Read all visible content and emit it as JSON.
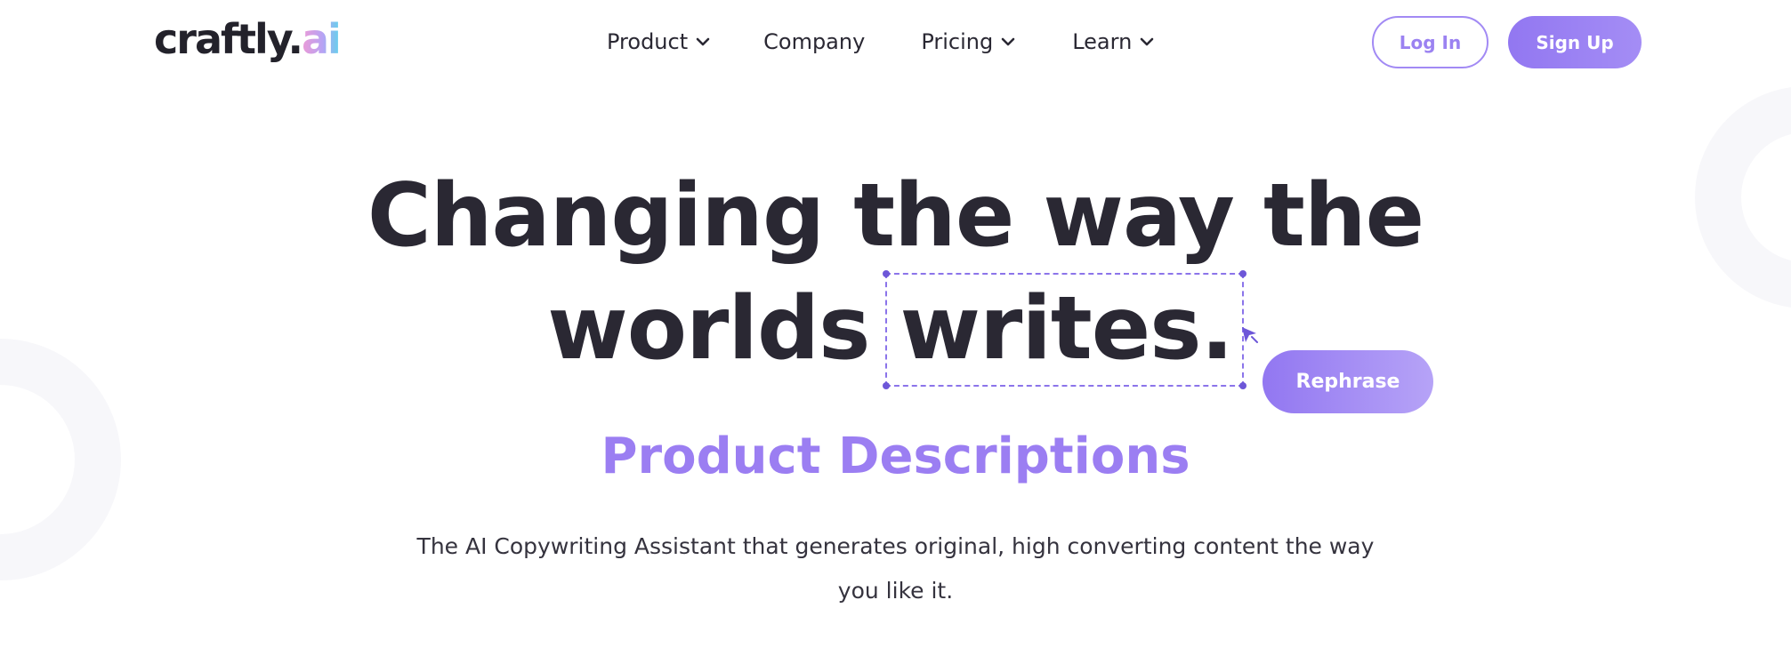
{
  "header": {
    "logo": {
      "main": "craftly.",
      "accent": "ai"
    },
    "nav": [
      {
        "label": "Product",
        "has_dropdown": true
      },
      {
        "label": "Company",
        "has_dropdown": false
      },
      {
        "label": "Pricing",
        "has_dropdown": true
      },
      {
        "label": "Learn",
        "has_dropdown": true
      }
    ],
    "login_label": "Log In",
    "signup_label": "Sign Up"
  },
  "hero": {
    "line1": "Changing the way the",
    "line2_start": "worlds",
    "line2_highlight": "writes.",
    "rephrase_label": "Rephrase",
    "subheading": "Product Descriptions",
    "description": "The AI Copywriting Assistant that generates original, high converting content the way you like it."
  },
  "colors": {
    "accent": "#9b7ef2",
    "text": "#2a2833",
    "button_gradient_start": "#9277f1",
    "button_gradient_end": "#b6a3f7"
  },
  "icons": {
    "dropdown": "chevron-down-icon",
    "cursor": "cursor-arrow-icon"
  }
}
